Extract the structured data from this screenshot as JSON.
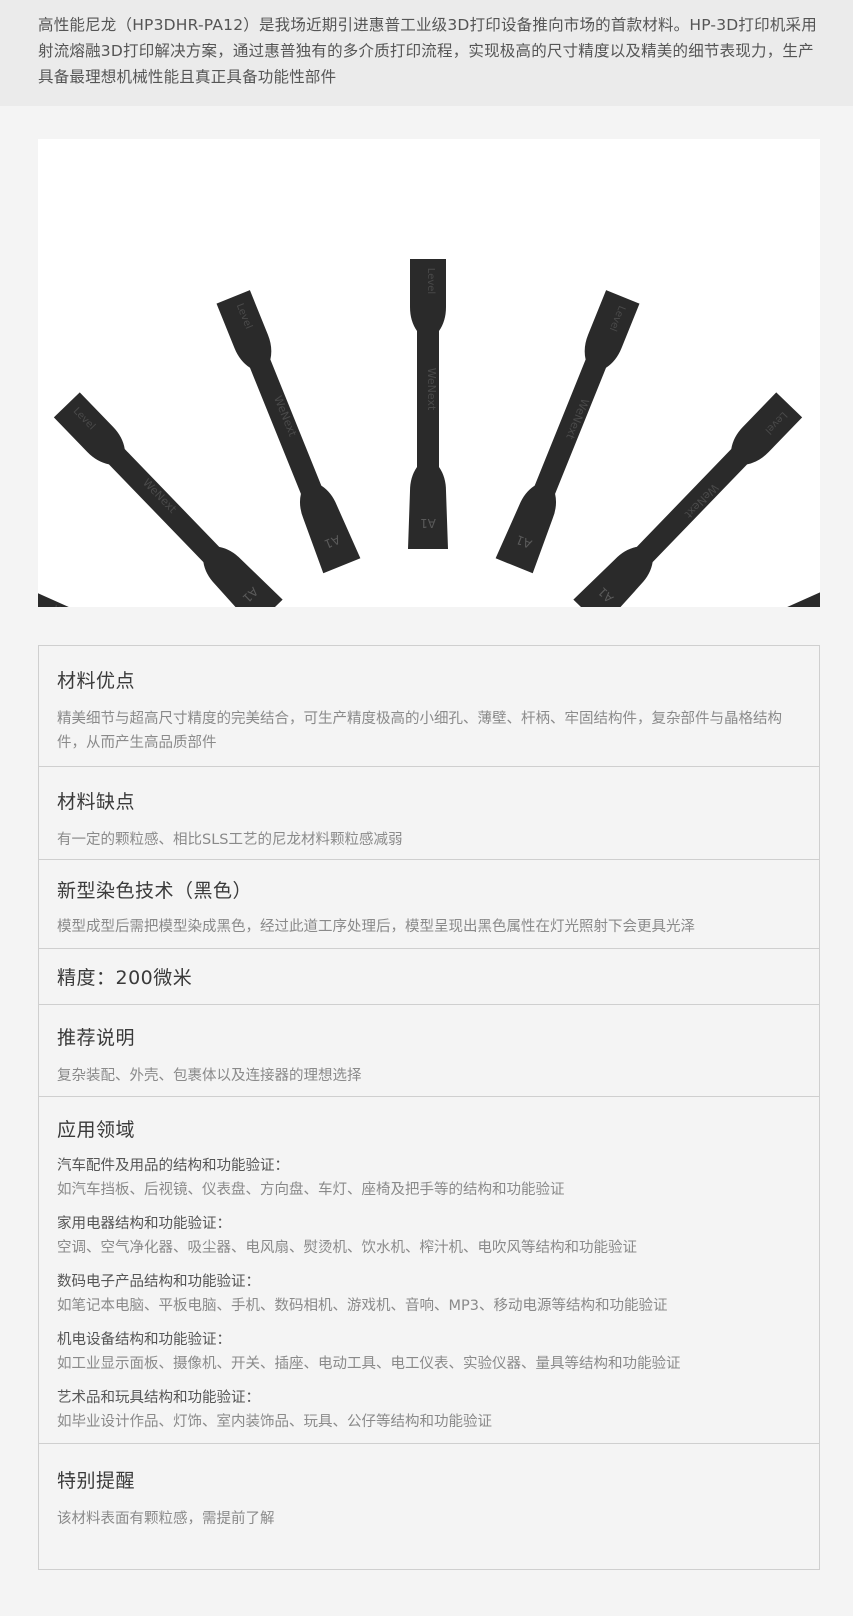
{
  "intro": {
    "text": "高性能尼龙（HP3DHR-PA12）是我场近期引进惠普工业级3D打印设备推向市场的首款材料。HP-3D打印机采用射流熔融3D打印解决方案，通过惠普独有的多介质打印流程，实现极高的尺寸精度以及精美的细节表现力，生产具备最理想机械性能且真正具备功能性部件"
  },
  "photo": {
    "specimen_top_label": "Level",
    "specimen_brand": "WeNext",
    "specimen_bottom_label": "A1",
    "colors": {
      "specimen": "#2a2a2a",
      "background": "#ffffff"
    }
  },
  "specs": {
    "advantages": {
      "title": "材料优点",
      "desc": "精美细节与超高尺寸精度的完美结合，可生产精度极高的小细孔、薄壁、杆柄、牢固结构件，复杂部件与晶格结构件，从而产生高品质部件"
    },
    "disadvantages": {
      "title": "材料缺点",
      "desc": "有一定的颗粒感、相比SLS工艺的尼龙材料颗粒感减弱"
    },
    "dyeing": {
      "title": "新型染色技术（黑色）",
      "desc": "模型成型后需把模型染成黑色，经过此道工序处理后，模型呈现出黑色属性在灯光照射下会更具光泽"
    },
    "precision": {
      "title": "精度：200微米"
    },
    "recommendation": {
      "title": "推荐说明",
      "desc": "复杂装配、外壳、包裹体以及连接器的理想选择"
    },
    "applications": {
      "title": "应用领域",
      "groups": [
        {
          "label": "汽车配件及用品的结构和功能验证：",
          "desc": "如汽车挡板、后视镜、仪表盘、方向盘、车灯、座椅及把手等的结构和功能验证"
        },
        {
          "label": "家用电器结构和功能验证：",
          "desc": "空调、空气净化器、吸尘器、电风扇、熨烫机、饮水机、榨汁机、电吹风等结构和功能验证"
        },
        {
          "label": "数码电子产品结构和功能验证：",
          "desc": "如笔记本电脑、平板电脑、手机、数码相机、游戏机、音响、MP3、移动电源等结构和功能验证"
        },
        {
          "label": "机电设备结构和功能验证：",
          "desc": "如工业显示面板、摄像机、开关、插座、电动工具、电工仪表、实验仪器、量具等结构和功能验证"
        },
        {
          "label": "艺术品和玩具结构和功能验证：",
          "desc": "如毕业设计作品、灯饰、室内装饰品、玩具、公仔等结构和功能验证"
        }
      ]
    },
    "reminder": {
      "title": "特别提醒",
      "desc": "该材料表面有颗粒感，需提前了解"
    }
  }
}
